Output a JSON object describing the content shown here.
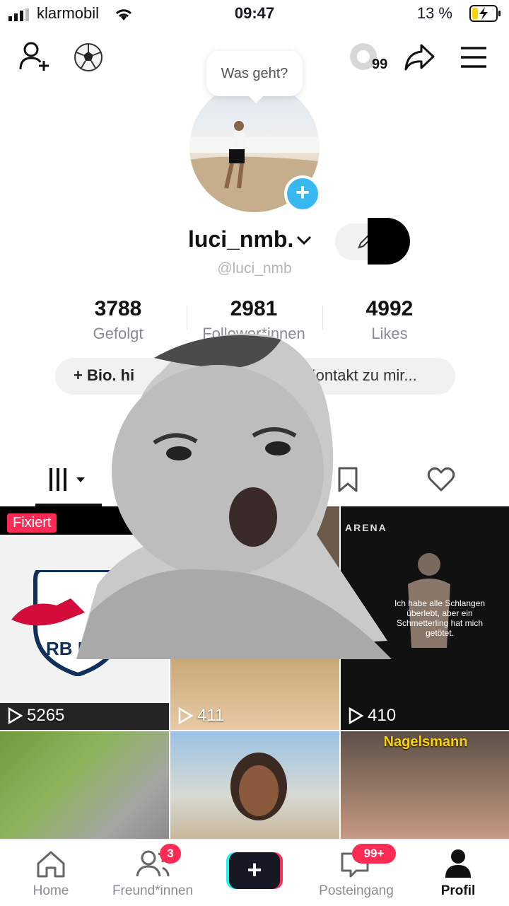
{
  "status_bar": {
    "carrier": "klarmobil",
    "time": "09:47",
    "battery": "13 %"
  },
  "header": {
    "views_count": "99"
  },
  "bubble": {
    "text": "Was geht?"
  },
  "profile": {
    "username": "luci_nmb.",
    "handle": "@luci_nmb",
    "stats": [
      {
        "value": "3788",
        "label": "Gefolgt"
      },
      {
        "value": "2981",
        "label": "Follower*innen"
      },
      {
        "value": "4992",
        "label": "Likes"
      }
    ],
    "bio_button": "+ Bio. hi",
    "contact_button": "Kontakt zu mir..."
  },
  "grid": {
    "pinned_label": "Fixiert",
    "tiles": [
      {
        "views": "5265"
      },
      {
        "views": "411"
      },
      {
        "views": "410",
        "overlay_title": "ARENA",
        "overlay_text": "Ich habe alle Schlangen überlebt, aber ein Schmetterling hat mich getötet."
      },
      {
        "views": ""
      },
      {
        "views": ""
      },
      {
        "views": "",
        "caption": "Nagelsmann"
      }
    ]
  },
  "nav": {
    "items": [
      {
        "label": "Home"
      },
      {
        "label": "Freund*innen",
        "badge": "3"
      },
      {
        "label": ""
      },
      {
        "label": "Posteingang",
        "badge": "99+"
      },
      {
        "label": "Profil"
      }
    ]
  },
  "colors": {
    "accent": "#fe2c55",
    "plus_badge": "#37b8f0",
    "create_cyan": "#25f4ee"
  }
}
